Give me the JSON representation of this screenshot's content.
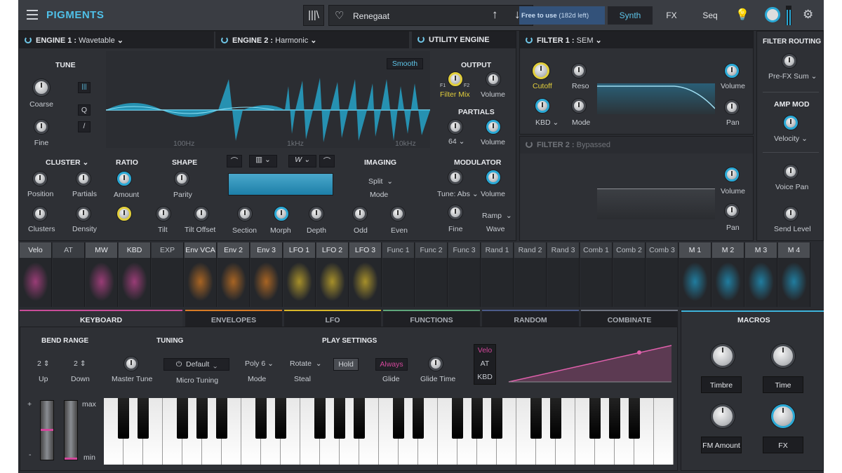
{
  "app": {
    "title": "PIGMENTS"
  },
  "header": {
    "preset_name": "Renegaat",
    "free_badge": "Free to use",
    "free_days": "(182d left)",
    "tabs": [
      "Synth",
      "FX",
      "Seq"
    ]
  },
  "engine1": {
    "label": "ENGINE 1 :",
    "type": "Wavetable"
  },
  "engine2": {
    "label": "ENGINE 2 :",
    "type": "Harmonic"
  },
  "utility": {
    "label": "UTILITY ENGINE"
  },
  "filter1": {
    "label": "FILTER 1 :",
    "type": "SEM"
  },
  "filter2": {
    "label": "FILTER 2 :",
    "type": "Bypassed"
  },
  "routing": {
    "label": "FILTER ROUTING",
    "mode": "Pre-FX Sum"
  },
  "tune": {
    "title": "TUNE",
    "coarse": "Coarse",
    "fine": "Fine",
    "q_btn": "Q"
  },
  "waveform": {
    "smooth": "Smooth",
    "ticks": [
      "100Hz",
      "1kHz",
      "10kHz"
    ]
  },
  "output": {
    "title": "OUTPUT",
    "filter_mix": "Filter Mix",
    "f1": "F1",
    "f2": "F2",
    "volume": "Volume"
  },
  "partials": {
    "title": "PARTIALS",
    "count": "64",
    "volume": "Volume"
  },
  "cluster": {
    "title": "CLUSTER",
    "position": "Position",
    "partials": "Partials",
    "clusters": "Clusters",
    "density": "Density"
  },
  "ratio": {
    "title": "RATIO",
    "amount": "Amount"
  },
  "shape": {
    "title": "SHAPE",
    "parity": "Parity",
    "tilt": "Tilt",
    "tilt_offset": "Tilt Offset",
    "section": "Section",
    "morph": "Morph",
    "depth": "Depth"
  },
  "imaging": {
    "title": "IMAGING",
    "mode_value": "Split",
    "mode": "Mode",
    "odd": "Odd",
    "even": "Even"
  },
  "modulator": {
    "title": "MODULATOR",
    "tune": "Tune: Abs",
    "volume": "Volume",
    "fine": "Fine",
    "wave_value": "Ramp",
    "wave": "Wave"
  },
  "filter1_knobs": {
    "cutoff": "Cutoff",
    "reso": "Reso",
    "kbd": "KBD",
    "mode": "Mode",
    "volume": "Volume",
    "pan": "Pan"
  },
  "filter2_knobs": {
    "volume": "Volume",
    "pan": "Pan"
  },
  "ampmod": {
    "title": "AMP MOD",
    "source": "Velocity",
    "voice_pan": "Voice Pan",
    "send_level": "Send Level"
  },
  "mod_slots": [
    "Velo",
    "AT",
    "MW",
    "KBD",
    "EXP",
    "Env VCA",
    "Env 2",
    "Env 3",
    "LFO 1",
    "LFO 2",
    "LFO 3",
    "Func 1",
    "Func 2",
    "Func 3",
    "Rand 1",
    "Rand 2",
    "Rand 3",
    "Comb 1",
    "Comb 2",
    "Comb 3",
    "M 1",
    "M 2",
    "M 3",
    "M 4"
  ],
  "bottom_tabs": [
    "KEYBOARD",
    "ENVELOPES",
    "LFO",
    "FUNCTIONS",
    "RANDOM",
    "COMBINATE"
  ],
  "macros": {
    "title": "MACROS",
    "items": [
      "Timbre",
      "Time",
      "FM Amount",
      "FX"
    ]
  },
  "keyboard": {
    "bend_title": "BEND RANGE",
    "up_val": "2",
    "down_val": "2",
    "up": "Up",
    "down": "Down",
    "tuning_title": "TUNING",
    "master_tune": "Master Tune",
    "tuning_preset": "Default",
    "micro_tuning": "Micro Tuning",
    "play_title": "PLAY SETTINGS",
    "poly": "Poly 6",
    "mode": "Mode",
    "rotate": "Rotate",
    "steal": "Steal",
    "hold": "Hold",
    "always": "Always",
    "glide": "Glide",
    "glide_time": "Glide Time",
    "vel_sources": [
      "Velo",
      "AT",
      "KBD"
    ],
    "max": "max",
    "min": "min",
    "plus": "+",
    "minus": "-"
  },
  "colors": {
    "accent": "#3fb6de",
    "panel": "#2e3035",
    "magenta": "#d2479b",
    "orange": "#e8821f",
    "yellow": "#e6c32a",
    "cyan": "#1ea7d8"
  }
}
